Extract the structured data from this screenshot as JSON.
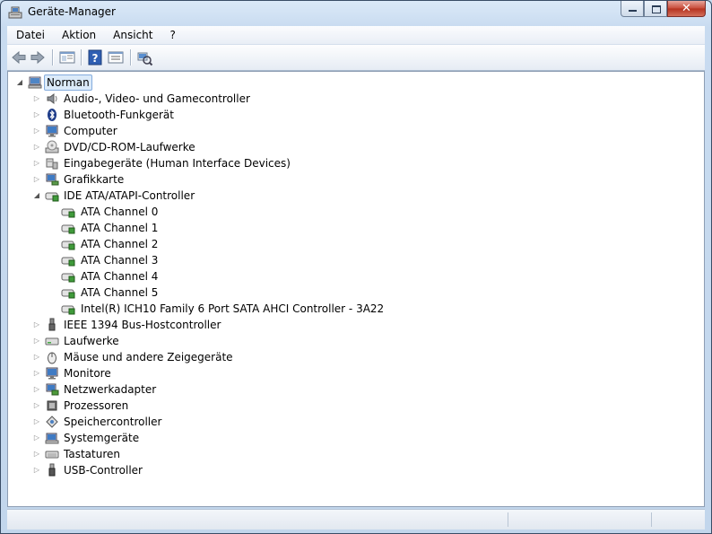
{
  "window": {
    "title": "Geräte-Manager",
    "icon": "device-manager-icon"
  },
  "caption_buttons": {
    "minimize": "minimize-icon",
    "maximize": "maximize-icon",
    "close_glyph": "✕"
  },
  "menu": {
    "items": [
      "Datei",
      "Aktion",
      "Ansicht",
      "?"
    ]
  },
  "toolbar": {
    "buttons": [
      "back-arrow-icon",
      "forward-arrow-icon",
      "show-hide-console-tree-icon",
      "help-icon",
      "properties-icon",
      "scan-hardware-icon"
    ]
  },
  "tree": {
    "root": {
      "label": "Norman",
      "icon": "computer-icon",
      "expanded": true,
      "selected": true
    },
    "categories": [
      {
        "label": "Audio-, Video- und Gamecontroller",
        "icon": "speaker-icon"
      },
      {
        "label": "Bluetooth-Funkgerät",
        "icon": "bluetooth-icon"
      },
      {
        "label": "Computer",
        "icon": "monitor-icon"
      },
      {
        "label": "DVD/CD-ROM-Laufwerke",
        "icon": "disc-drive-icon"
      },
      {
        "label": "Eingabegeräte (Human Interface Devices)",
        "icon": "hid-icon"
      },
      {
        "label": "Grafikkarte",
        "icon": "display-adapter-icon"
      },
      {
        "label": "IDE ATA/ATAPI-Controller",
        "icon": "ide-controller-icon",
        "expanded": true,
        "children": [
          "ATA Channel 0",
          "ATA Channel 1",
          "ATA Channel 2",
          "ATA Channel 3",
          "ATA Channel 4",
          "ATA Channel 5",
          "Intel(R) ICH10 Family 6 Port SATA AHCI Controller - 3A22"
        ]
      },
      {
        "label": "IEEE 1394 Bus-Hostcontroller",
        "icon": "firewire-icon"
      },
      {
        "label": "Laufwerke",
        "icon": "disk-drive-icon"
      },
      {
        "label": "Mäuse und andere Zeigegeräte",
        "icon": "mouse-icon"
      },
      {
        "label": "Monitore",
        "icon": "monitor-icon"
      },
      {
        "label": "Netzwerkadapter",
        "icon": "network-adapter-icon"
      },
      {
        "label": "Prozessoren",
        "icon": "processor-icon"
      },
      {
        "label": "Speichercontroller",
        "icon": "storage-controller-icon"
      },
      {
        "label": "Systemgeräte",
        "icon": "system-devices-icon"
      },
      {
        "label": "Tastaturen",
        "icon": "keyboard-icon"
      },
      {
        "label": "USB-Controller",
        "icon": "usb-icon"
      }
    ]
  },
  "statusbar": {
    "cells": [
      "",
      "",
      ""
    ]
  },
  "colors": {
    "selection_bg": "#dbeaf9",
    "selection_border": "#84acdd",
    "frame": "#c2d6ec"
  }
}
